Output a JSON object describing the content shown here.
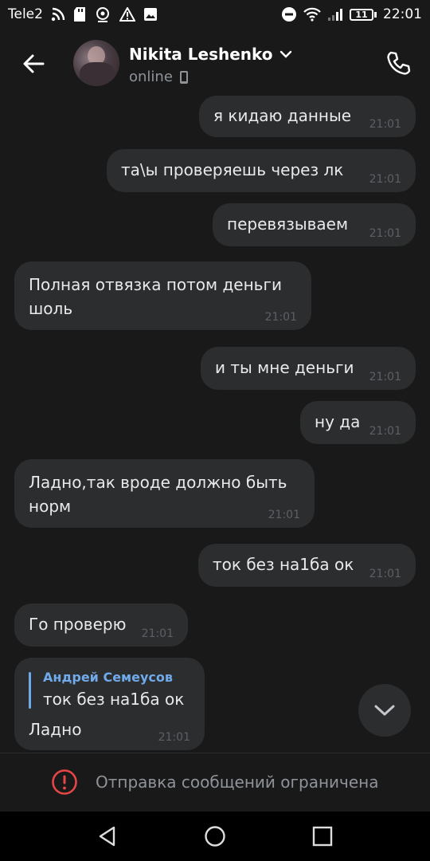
{
  "status_bar": {
    "carrier": "Tele2",
    "battery": "11",
    "time": "22:01"
  },
  "header": {
    "contact_name": "Nikita Leshenko",
    "status": "online"
  },
  "messages": [
    {
      "direction": "out",
      "text": "я кидаю данные",
      "time": "21:01"
    },
    {
      "direction": "out",
      "text": "та\\ы проверяешь через лк",
      "time": "21:01"
    },
    {
      "direction": "out",
      "text": "перевязываем",
      "time": "21:01"
    },
    {
      "direction": "in",
      "lines": [
        "Полная отвязка потом деньги",
        "шоль"
      ],
      "time": "21:01"
    },
    {
      "direction": "out",
      "text": "и ты мне деньги",
      "time": "21:01"
    },
    {
      "direction": "out",
      "text": "ну да",
      "time": "21:01"
    },
    {
      "direction": "in",
      "lines": [
        "Ладно,так вроде должно быть",
        "норм"
      ],
      "time": "21:01"
    },
    {
      "direction": "out",
      "text": "ток без на1ба ок",
      "time": "21:01"
    },
    {
      "direction": "in",
      "text": "Го проверю",
      "time": "21:01"
    },
    {
      "direction": "in",
      "reply_author": "Андрей Семеусов",
      "reply_text": "ток без на1ба ок",
      "text": "Ладно",
      "time": "21:01"
    }
  ],
  "restriction": {
    "text": "Отправка сообщений ограничена"
  },
  "icons": {
    "back": "arrow-left-icon",
    "call": "phone-icon",
    "scroll_down": "chevron-down-icon",
    "warning": "exclamation-circle-icon"
  },
  "colors": {
    "background": "#19191a",
    "bubble": "#2c2d2e",
    "accent": "#71aaeb",
    "warning": "#e64646"
  }
}
